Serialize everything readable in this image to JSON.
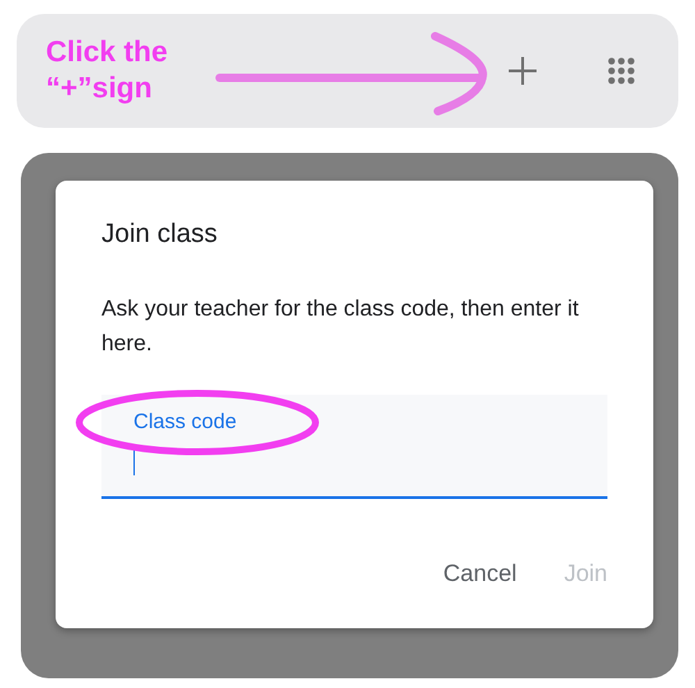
{
  "toolbar": {
    "annotation": "Click the “+”sign",
    "buttons": [
      {
        "kind": "add"
      },
      {
        "kind": "apps"
      }
    ]
  },
  "dialog": {
    "title": "Join class",
    "message": "Ask your teacher for the class code, then enter it here.",
    "field": {
      "label": "Class code",
      "focused": true,
      "highlighted": true
    },
    "buttons": [
      {
        "label": "Cancel",
        "disabled": false
      },
      {
        "label": "Join",
        "disabled": true
      }
    ]
  }
}
